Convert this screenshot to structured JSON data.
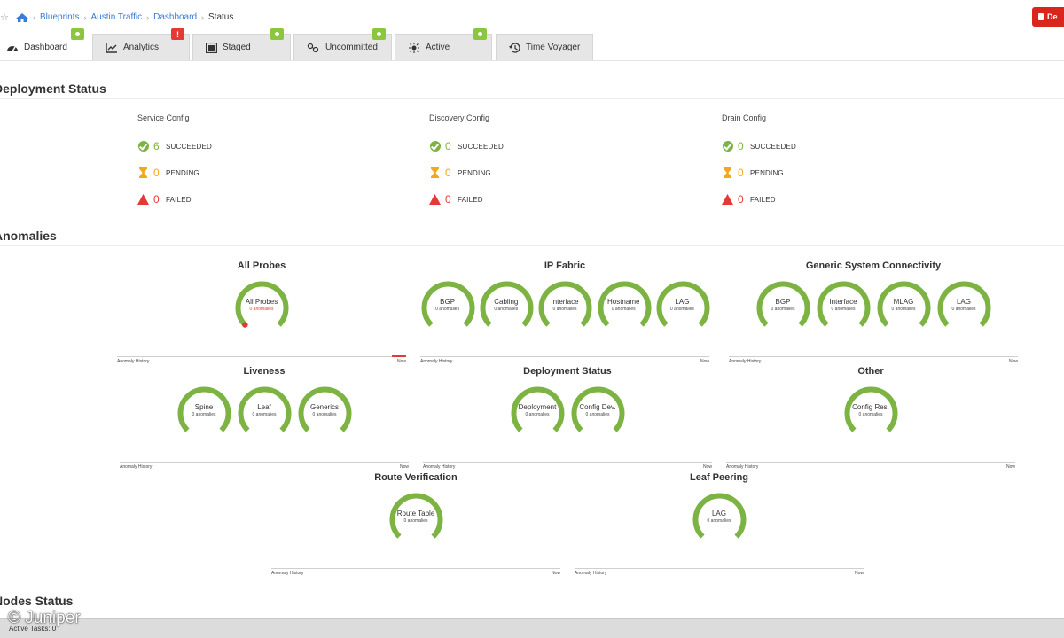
{
  "breadcrumb": {
    "items": [
      "Blueprints",
      "Austin Traffic",
      "Dashboard"
    ],
    "current": "Status"
  },
  "delete_button": {
    "label": "De"
  },
  "tabs": [
    {
      "label": "Dashboard",
      "icon": "dashboard-icon",
      "active": true
    },
    {
      "label": "Analytics",
      "icon": "analytics-chart-icon",
      "badge": "warning"
    },
    {
      "label": "Staged",
      "icon": "staged-icon",
      "badge": "ok"
    },
    {
      "label": "Uncommitted",
      "icon": "uncommitted-icon",
      "badge": "ok"
    },
    {
      "label": "Active",
      "icon": "active-icon",
      "badge": "ok"
    },
    {
      "label": "Time Voyager",
      "icon": "history-icon"
    }
  ],
  "deployment_status": {
    "title": "Deployment Status",
    "columns": [
      {
        "title": "Service Config",
        "succeeded": "6",
        "pending": "0",
        "failed": "0"
      },
      {
        "title": "Discovery Config",
        "succeeded": "0",
        "pending": "0",
        "failed": "0"
      },
      {
        "title": "Drain Config",
        "succeeded": "0",
        "pending": "0",
        "failed": "0"
      }
    ],
    "labels": {
      "succeeded": "SUCCEEDED",
      "pending": "PENDING",
      "failed": "FAILED"
    }
  },
  "anomalies": {
    "title": "Anomalies",
    "history_label": "Anomaly History",
    "now_label": "Now",
    "gauge_sub": "0 anomalies",
    "groups": {
      "all_probes": {
        "title": "All Probes",
        "gauges": [
          "All Probes"
        ]
      },
      "ip_fabric": {
        "title": "IP Fabric",
        "gauges": [
          "BGP",
          "Cabling",
          "Interface",
          "Hostname",
          "LAG"
        ]
      },
      "generic_system": {
        "title": "Generic System Connectivity",
        "gauges": [
          "BGP",
          "Interface",
          "MLAG",
          "LAG"
        ]
      },
      "liveness": {
        "title": "Liveness",
        "gauges": [
          "Spine",
          "Leaf",
          "Generics"
        ]
      },
      "deployment": {
        "title": "Deployment Status",
        "gauges": [
          "Deployment",
          "Config Dev."
        ]
      },
      "other": {
        "title": "Other",
        "gauges": [
          "Config Res."
        ]
      },
      "route_verification": {
        "title": "Route Verification",
        "gauges": [
          "Route Table"
        ]
      },
      "leaf_peering": {
        "title": "Leaf Peering",
        "gauges": [
          "LAG"
        ]
      }
    }
  },
  "nodes_status": {
    "title": "Nodes Status"
  },
  "footer": {
    "active_tasks": "Active Tasks: 0"
  },
  "watermark": "© Juniper",
  "colors": {
    "accent_green": "#7cb342",
    "warning_red": "#e53935",
    "pending_amber": "#f2a81d",
    "link_blue": "#3a7bd5"
  }
}
